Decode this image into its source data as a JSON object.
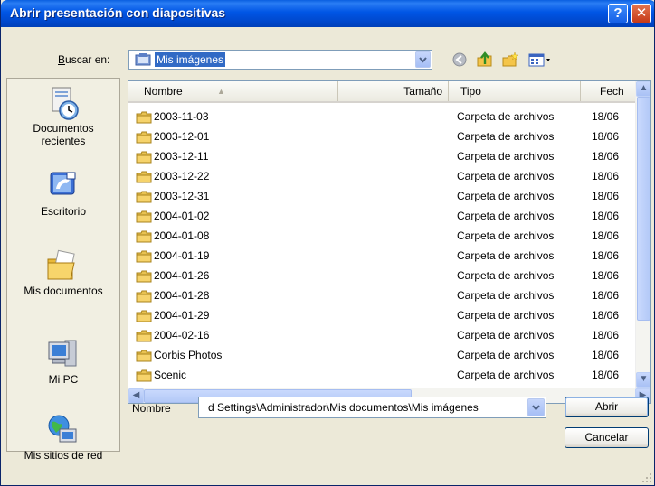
{
  "window": {
    "title": "Abrir presentación con diapositivas",
    "help_glyph": "?",
    "close_glyph": "✕"
  },
  "lookin": {
    "label_prefix": "B",
    "label_rest": "uscar en:",
    "value": "Mis imágenes",
    "icons": [
      "back-icon",
      "up-folder-icon",
      "new-folder-icon",
      "view-menu-icon"
    ]
  },
  "places": [
    {
      "icon": "recent-documents-icon",
      "label1": "Documentos",
      "label2": "recientes"
    },
    {
      "icon": "desktop-icon",
      "label1": "Escritorio",
      "label2": ""
    },
    {
      "icon": "my-documents-icon",
      "label1": "Mis documentos",
      "label2": ""
    },
    {
      "icon": "my-computer-icon",
      "label1": "Mi PC",
      "label2": ""
    },
    {
      "icon": "network-places-icon",
      "label1": "Mis sitios de red",
      "label2": ""
    }
  ],
  "columns": {
    "name": "Nombre",
    "size": "Tamaño",
    "type": "Tipo",
    "date": "Fech"
  },
  "files": [
    {
      "name": "2003-11-03",
      "type": "Carpeta de archivos",
      "date": "18/06"
    },
    {
      "name": "2003-12-01",
      "type": "Carpeta de archivos",
      "date": "18/06"
    },
    {
      "name": "2003-12-11",
      "type": "Carpeta de archivos",
      "date": "18/06"
    },
    {
      "name": "2003-12-22",
      "type": "Carpeta de archivos",
      "date": "18/06"
    },
    {
      "name": "2003-12-31",
      "type": "Carpeta de archivos",
      "date": "18/06"
    },
    {
      "name": "2004-01-02",
      "type": "Carpeta de archivos",
      "date": "18/06"
    },
    {
      "name": "2004-01-08",
      "type": "Carpeta de archivos",
      "date": "18/06"
    },
    {
      "name": "2004-01-19",
      "type": "Carpeta de archivos",
      "date": "18/06"
    },
    {
      "name": "2004-01-26",
      "type": "Carpeta de archivos",
      "date": "18/06"
    },
    {
      "name": "2004-01-28",
      "type": "Carpeta de archivos",
      "date": "18/06"
    },
    {
      "name": "2004-01-29",
      "type": "Carpeta de archivos",
      "date": "18/06"
    },
    {
      "name": "2004-02-16",
      "type": "Carpeta de archivos",
      "date": "18/06"
    },
    {
      "name": "Corbis Photos",
      "type": "Carpeta de archivos",
      "date": "18/06"
    },
    {
      "name": "Scenic",
      "type": "Carpeta de archivos",
      "date": "18/06"
    }
  ],
  "scroll": {
    "up": "▲",
    "down": "▼",
    "left": "◀",
    "right": "▶"
  },
  "filename": {
    "label": "Nombre",
    "value": "d Settings\\Administrador\\Mis documentos\\Mis imágenes"
  },
  "buttons": {
    "open": "Abrir",
    "cancel": "Cancelar"
  },
  "colors": {
    "titlebar": "#0055e5",
    "selection": "#316ac5",
    "dialog_bg": "#ece9d8",
    "folder": "#f6d36b"
  }
}
